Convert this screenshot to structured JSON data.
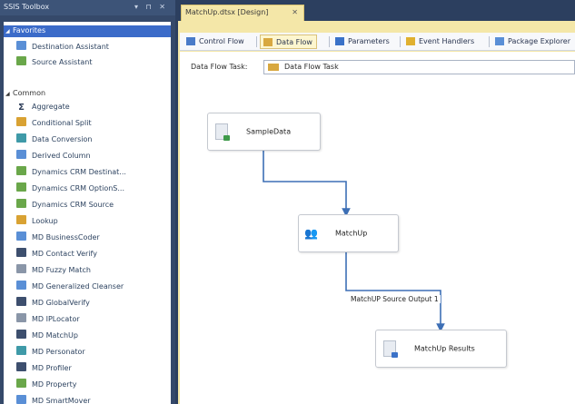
{
  "toolbox": {
    "title": "SSIS Toolbox",
    "title_buttons": "▾ ⊓ ✕",
    "favorites": {
      "header": "Favorites",
      "items": [
        {
          "label": "Destination Assistant",
          "icon": "destination-assistant-icon"
        },
        {
          "label": "Source Assistant",
          "icon": "source-assistant-icon"
        }
      ]
    },
    "common": {
      "header": "Common",
      "items": [
        {
          "label": "Aggregate",
          "icon": "aggregate-icon"
        },
        {
          "label": "Conditional Split",
          "icon": "conditional-split-icon"
        },
        {
          "label": "Data Conversion",
          "icon": "data-conversion-icon"
        },
        {
          "label": "Derived Column",
          "icon": "derived-column-icon"
        },
        {
          "label": "Dynamics CRM Destinat...",
          "icon": "dynamics-crm-icon"
        },
        {
          "label": "Dynamics CRM OptionS...",
          "icon": "dynamics-crm-icon"
        },
        {
          "label": "Dynamics CRM Source",
          "icon": "dynamics-crm-icon"
        },
        {
          "label": "Lookup",
          "icon": "lookup-icon"
        },
        {
          "label": "MD BusinessCoder",
          "icon": "md-businesscoder-icon"
        },
        {
          "label": "MD Contact Verify",
          "icon": "md-contact-verify-icon"
        },
        {
          "label": "MD Fuzzy Match",
          "icon": "md-fuzzy-match-icon"
        },
        {
          "label": "MD Generalized Cleanser",
          "icon": "md-generalized-cleanser-icon"
        },
        {
          "label": "MD GlobalVerify",
          "icon": "md-globalverify-icon"
        },
        {
          "label": "MD IPLocator",
          "icon": "md-iplocator-icon"
        },
        {
          "label": "MD MatchUp",
          "icon": "md-matchup-icon"
        },
        {
          "label": "MD Personator",
          "icon": "md-personator-icon"
        },
        {
          "label": "MD Profiler",
          "icon": "md-profiler-icon"
        },
        {
          "label": "MD Property",
          "icon": "md-property-icon"
        },
        {
          "label": "MD SmartMover",
          "icon": "md-smartmover-icon"
        }
      ]
    }
  },
  "document_tab": {
    "title": "MatchUp.dtsx [Design]",
    "close": "✕"
  },
  "designer_tabs": [
    {
      "label": "Control Flow",
      "icon": "control-flow-icon",
      "active": false
    },
    {
      "label": "Data Flow",
      "icon": "data-flow-icon",
      "active": true
    },
    {
      "label": "Parameters",
      "icon": "parameters-icon",
      "active": false
    },
    {
      "label": "Event Handlers",
      "icon": "event-handlers-icon",
      "active": false
    },
    {
      "label": "Package Explorer",
      "icon": "package-explorer-icon",
      "active": false
    }
  ],
  "task_bar": {
    "label": "Data Flow Task:",
    "selected_task": "Data Flow Task"
  },
  "canvas": {
    "nodes": [
      {
        "label": "SampleData",
        "icon": "source-component-icon"
      },
      {
        "label": "MatchUp",
        "icon": "matchup-people-icon"
      },
      {
        "label": "MatchUp Results",
        "icon": "destination-component-icon"
      }
    ],
    "path_label": "MatchUP Source Output 1"
  },
  "colors": {
    "toolbox_selected": "#3b6bc9",
    "document_frame": "#f4e7a8",
    "path_line": "#3d6fb5",
    "panel_background": "#35496a"
  }
}
